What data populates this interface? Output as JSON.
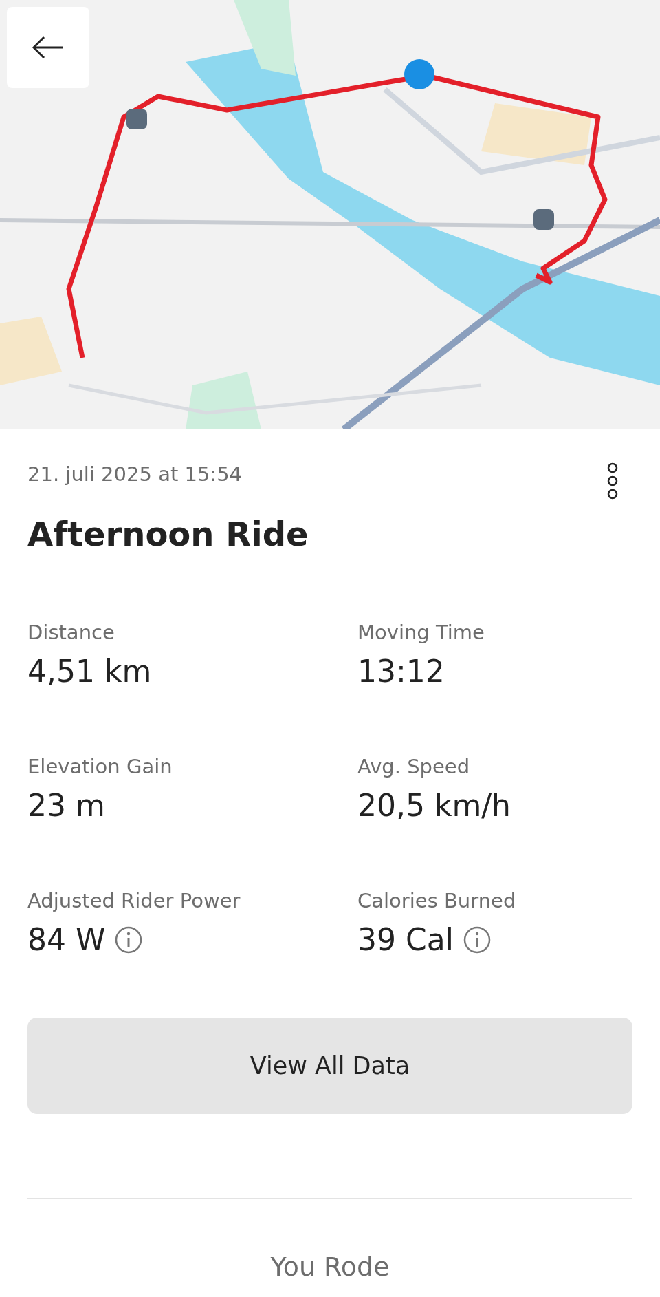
{
  "activity": {
    "date": "21. juli 2025 at 15:54",
    "title": "Afternoon Ride"
  },
  "stats": [
    {
      "label": "Distance",
      "value": "4,51 km",
      "info_icon": false
    },
    {
      "label": "Moving Time",
      "value": "13:12",
      "info_icon": false
    },
    {
      "label": "Elevation Gain",
      "value": "23 m",
      "info_icon": false
    },
    {
      "label": "Avg. Speed",
      "value": "20,5 km/h",
      "info_icon": false
    },
    {
      "label": "Adjusted Rider Power",
      "value": "84 W",
      "info_icon": true
    },
    {
      "label": "Calories Burned",
      "value": "39 Cal",
      "info_icon": true
    }
  ],
  "primary_button": "View All Data",
  "section_heading": "You Rode"
}
